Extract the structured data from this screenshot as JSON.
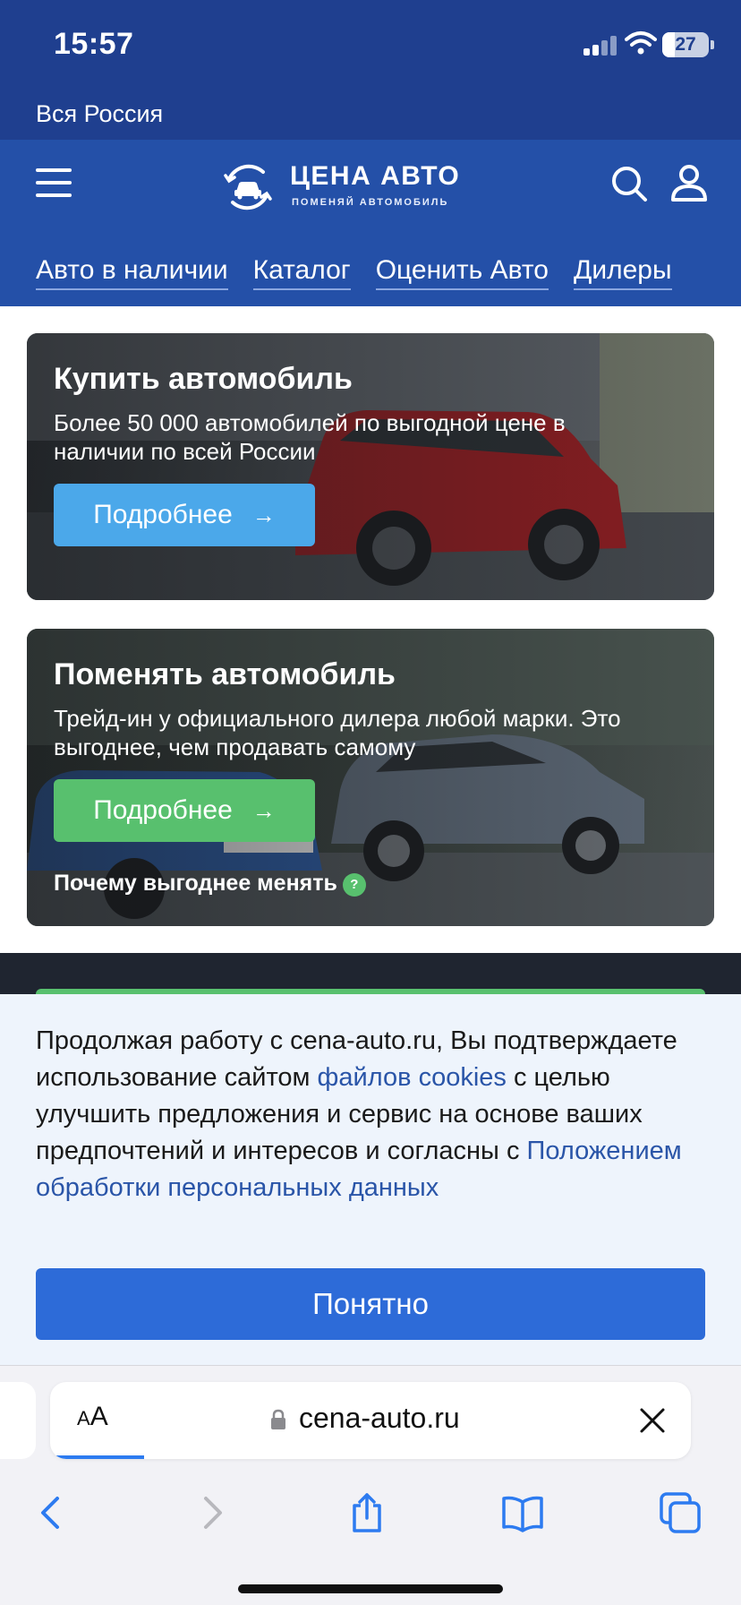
{
  "status_bar": {
    "time": "15:57",
    "battery": "27",
    "battery_level": 0.27
  },
  "region": {
    "label": "Вся Россия"
  },
  "header": {
    "logo_title": "ЦЕНА АВТО",
    "logo_subtitle": "ПОМЕНЯЙ АВТОМОБИЛЬ",
    "icons": [
      "menu-icon",
      "search-icon",
      "user-icon"
    ],
    "nav": [
      "Авто в наличии",
      "Каталог",
      "Оценить Авто",
      "Дилеры"
    ]
  },
  "cards": [
    {
      "title": "Купить автомобиль",
      "description": "Более 50 000 автомобилей по выгодной цене в наличии по всей России",
      "button": "Подробнее",
      "button_color": "#4ba8ea"
    },
    {
      "title": "Поменять автомобиль",
      "description": "Трейд-ин у официального дилера любой марки. Это выгоднее, чем продавать самому",
      "button": "Подробнее",
      "button_color": "#58c06e",
      "link": "Почему выгоднее менять",
      "help_icon": "?"
    }
  ],
  "cookie": {
    "text_1": "Продолжая работу с cena-auto.ru, Вы подтверждаете использование сайтом ",
    "link_1": "файлов cookies",
    "text_2": " с целью улучшить предложения и сервис на основе ваших предпочтений и интересов и согласны с ",
    "link_2": "Положением обработки персональных данных",
    "button": "Понятно"
  },
  "browser": {
    "aa_label": "AA",
    "url": "cena-auto.ru",
    "toolbar": [
      "back-icon",
      "forward-icon",
      "share-icon",
      "bookmarks-icon",
      "tabs-icon"
    ]
  },
  "colors": {
    "header": "#2450a8",
    "status": "#1f3f8f",
    "accent": "#2d6bd8"
  }
}
